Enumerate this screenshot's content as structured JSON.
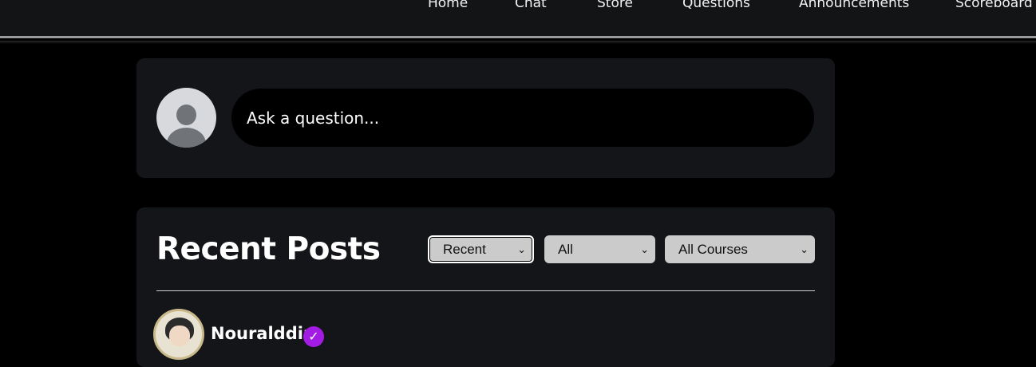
{
  "nav": {
    "items": [
      {
        "label": "Home"
      },
      {
        "label": "Chat"
      },
      {
        "label": "Store"
      },
      {
        "label": "Questions"
      },
      {
        "label": "Announcements"
      },
      {
        "label": "Scoreboard"
      }
    ]
  },
  "ask": {
    "placeholder": "Ask a question..."
  },
  "posts": {
    "title": "Recent Posts",
    "filters": {
      "sort": "Recent",
      "category": "All",
      "course": "All Courses"
    },
    "first_post": {
      "author": "Nouralddin"
    }
  },
  "icons": {
    "user_avatar": "user-avatar-icon",
    "dropdown": "chevron-down-icon",
    "verified": "check-badge-icon"
  },
  "colors": {
    "background": "#000000",
    "card": "#141518",
    "verified_badge": "#a21ce4",
    "select_bg": "#cbcbcb"
  }
}
